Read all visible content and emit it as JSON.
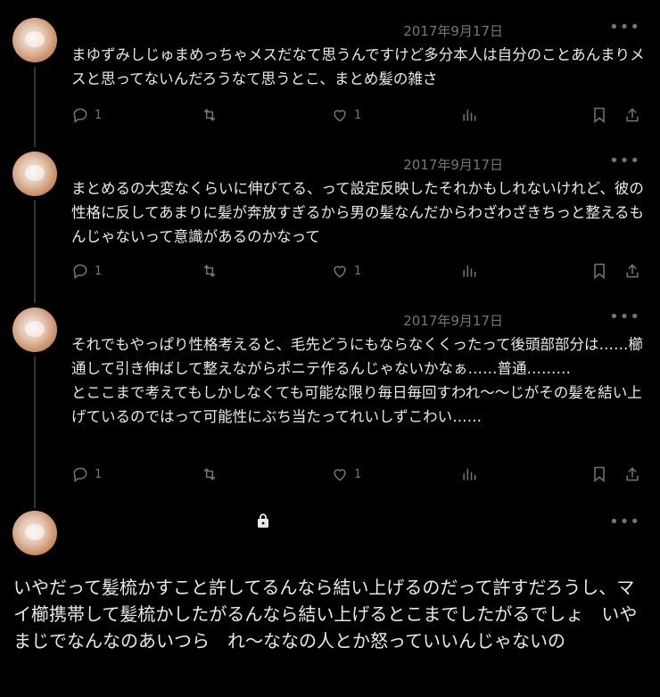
{
  "tweets": [
    {
      "date": "2017年9月17日",
      "text": "まゆずみしじゅまめっちゃメスだなて思うんですけど多分本人は自分のことあんまりメスと思ってないんだろうなて思うとこ、まとめ髪の雑さ",
      "reply_count": "1",
      "like_count": "1"
    },
    {
      "date": "2017年9月17日",
      "text": "まとめるの大変なくらいに伸びてる、って設定反映したそれかもしれないけれど、彼の性格に反してあまりに髪が奔放すぎるから男の髪なんだからわざわざきちっと整えるもんじゃないって意識があるのかなって",
      "reply_count": "1",
      "like_count": "1"
    },
    {
      "date": "2017年9月17日",
      "text": "それでもやっぱり性格考えると、毛先どうにもならなくくったって後頭部部分は……櫛通して引き伸ばして整えながらポニテ作るんじゃないかなぁ……普通………\nとここまで考えてもしかしなくても可能な限り毎日毎回すわれ〜〜じがその髪を結い上げているのではって可能性にぶち当たってれいしずこわい……",
      "reply_count": "1",
      "like_count": "1"
    }
  ],
  "main_tweet": {
    "text": "いやだって髪梳かすこと許してるんなら結い上げるのだって許すだろうし、マイ櫛携帯して髪梳かしたがるんなら結い上げるとこまでしたがるでしょ　いやまじでなんなのあいつら　れ〜ななの人とか怒っていいんじゃないの"
  },
  "icons": {
    "reply": "reply-icon",
    "retweet": "retweet-icon",
    "like": "heart-icon",
    "views": "analytics-icon",
    "bookmark": "bookmark-icon",
    "share": "share-icon",
    "more": "more-icon",
    "lock": "lock-icon"
  },
  "colors": {
    "background": "#000000",
    "text": "#e7e9ea",
    "muted": "#71767b"
  }
}
